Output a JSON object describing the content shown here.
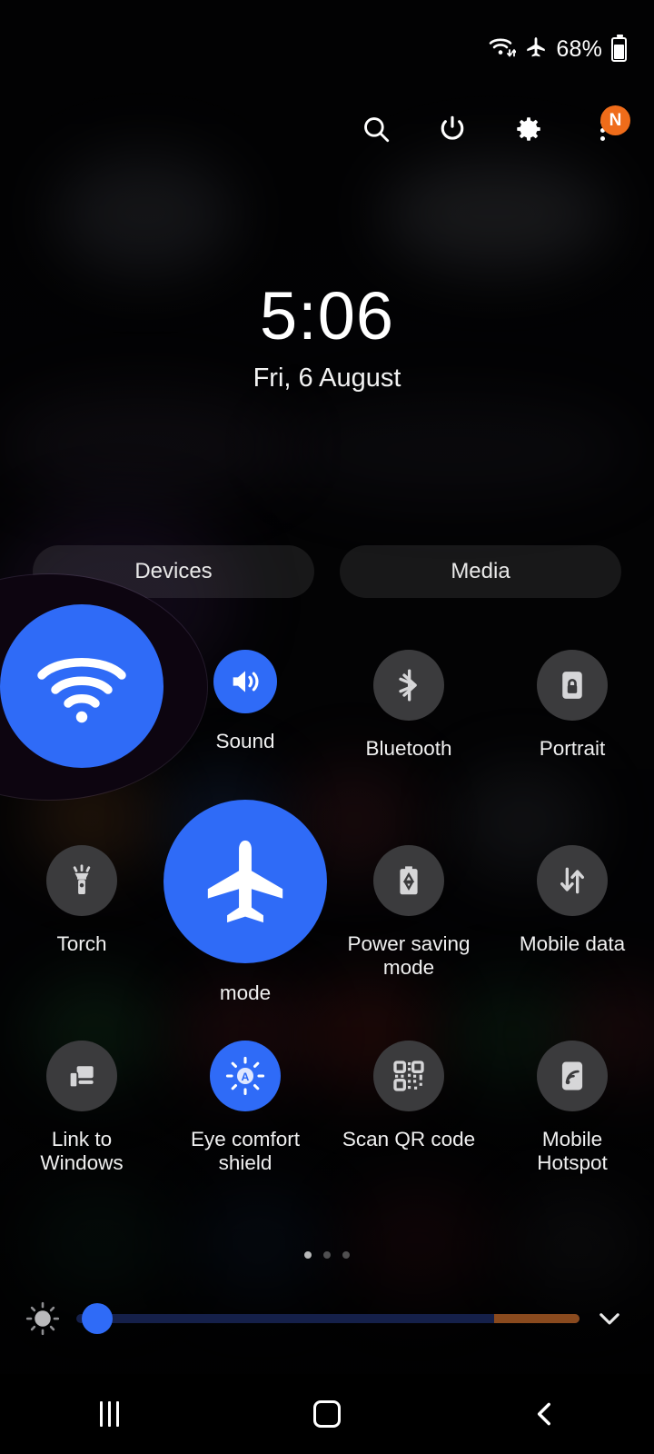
{
  "status_bar": {
    "wifi_icon": "wifi-icon",
    "airplane_icon": "airplane-icon",
    "battery_percent": "68%",
    "battery_icon": "battery-icon"
  },
  "header": {
    "search_icon": "search-icon",
    "power_icon": "power-icon",
    "settings_icon": "gear-icon",
    "more_icon": "more-vertical-icon",
    "badge_label": "N",
    "badge_color": "#ef6c1a"
  },
  "clock": {
    "time": "5:06",
    "date": "Fri, 6 August"
  },
  "tabs": [
    {
      "label": "Devices",
      "name": "tab-devices"
    },
    {
      "label": "Media",
      "name": "tab-media"
    }
  ],
  "accent_color": "#2f6bf7",
  "inactive_color": "#3b3b3d",
  "tiles": [
    {
      "label": "",
      "icon": "wifi-icon",
      "state": "on",
      "zoomed": true,
      "name": "tile-wifi"
    },
    {
      "label": "Sound",
      "icon": "volume-up-icon",
      "state": "on",
      "zoomed": false,
      "name": "tile-sound"
    },
    {
      "label": "Bluetooth",
      "icon": "bluetooth-icon",
      "state": "off",
      "zoomed": false,
      "name": "tile-bluetooth"
    },
    {
      "label": "Portrait",
      "icon": "rotation-lock-icon",
      "state": "off",
      "zoomed": false,
      "name": "tile-portrait"
    },
    {
      "label": "Torch",
      "icon": "flashlight-icon",
      "state": "off",
      "zoomed": false,
      "name": "tile-torch"
    },
    {
      "label": "mode",
      "icon": "airplane-icon",
      "state": "on",
      "zoomed": true,
      "name": "tile-flight-mode"
    },
    {
      "label": "Power saving mode",
      "icon": "power-saving-icon",
      "state": "off",
      "zoomed": false,
      "name": "tile-power-saving"
    },
    {
      "label": "Mobile data",
      "icon": "data-arrows-icon",
      "state": "off",
      "zoomed": false,
      "name": "tile-mobile-data"
    },
    {
      "label": "Link to Windows",
      "icon": "link-windows-icon",
      "state": "off",
      "zoomed": false,
      "name": "tile-link-to-windows"
    },
    {
      "label": "Eye comfort shield",
      "icon": "eye-comfort-icon",
      "state": "on",
      "zoomed": false,
      "name": "tile-eye-comfort-shield"
    },
    {
      "label": "Scan QR code",
      "icon": "qr-code-icon",
      "state": "off",
      "zoomed": false,
      "name": "tile-scan-qr-code"
    },
    {
      "label": "Mobile Hotspot",
      "icon": "hotspot-icon",
      "state": "off",
      "zoomed": false,
      "name": "tile-mobile-hotspot"
    }
  ],
  "pager": {
    "pages": 3,
    "active_index": 0
  },
  "brightness": {
    "icon": "brightness-icon",
    "value_percent": 6,
    "warm_segment_percent": 17,
    "expand_icon": "chevron-down-icon",
    "track_color": "#15204a",
    "warm_color": "#8a4a1e"
  },
  "nav_bar": {
    "recents_icon": "recents-icon",
    "home_icon": "home-icon",
    "back_icon": "back-icon"
  }
}
